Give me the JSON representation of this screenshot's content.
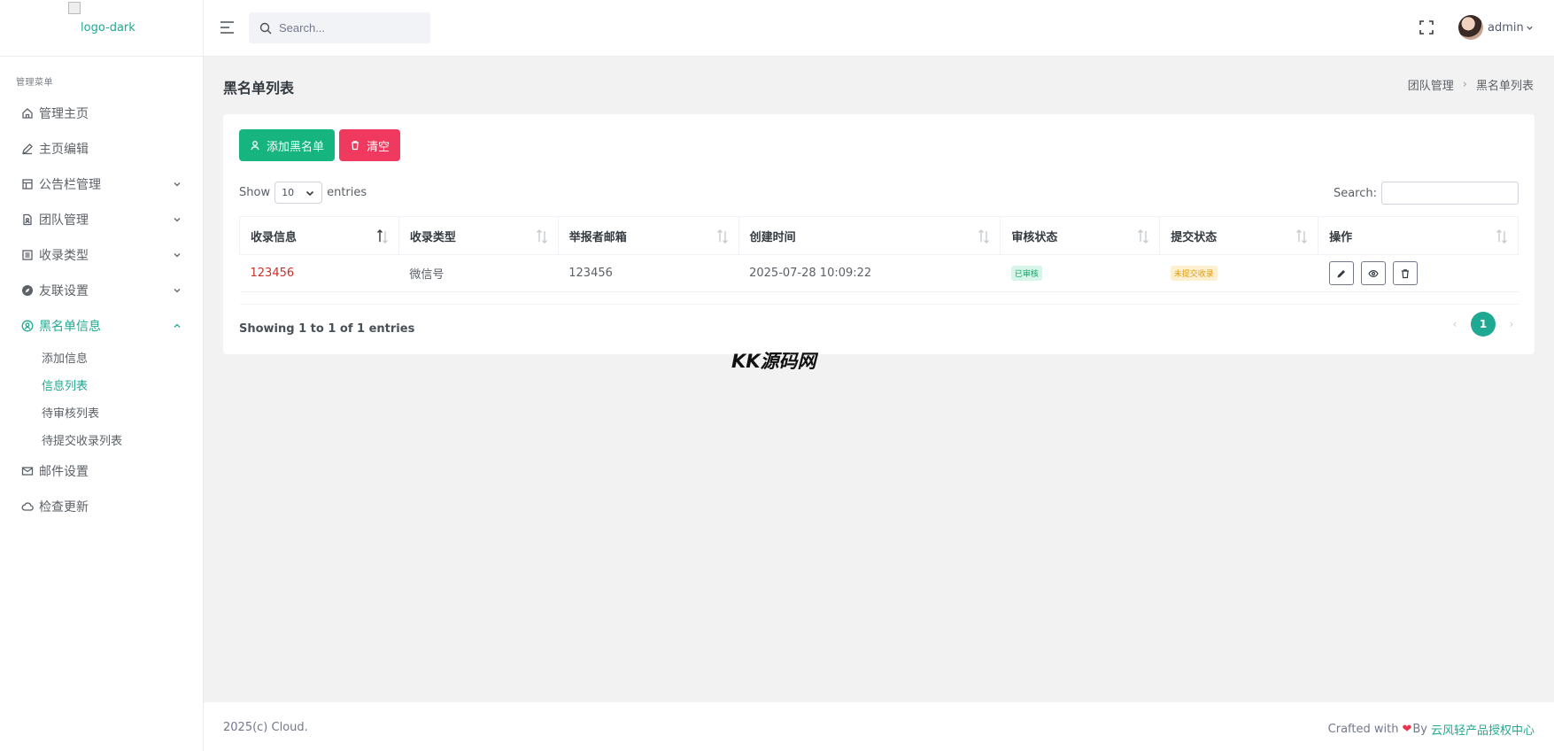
{
  "logo": {
    "alt": "logo-dark"
  },
  "search": {
    "placeholder": "Search..."
  },
  "user": {
    "name": "admin"
  },
  "sidebar": {
    "menu_title": "管理菜单",
    "items": [
      {
        "label": "管理主页",
        "icon": "home-icon"
      },
      {
        "label": "主页编辑",
        "icon": "edit-icon"
      },
      {
        "label": "公告栏管理",
        "icon": "layout-icon"
      },
      {
        "label": "团队管理",
        "icon": "file-user-icon"
      },
      {
        "label": "收录类型",
        "icon": "list-box-icon"
      },
      {
        "label": "友联设置",
        "icon": "compass-icon"
      },
      {
        "label": "黑名单信息",
        "icon": "user-pin-icon"
      }
    ],
    "sub_items": [
      {
        "label": "添加信息"
      },
      {
        "label": "信息列表"
      },
      {
        "label": "待审核列表"
      },
      {
        "label": "待提交收录列表"
      }
    ],
    "bottom_items": [
      {
        "label": "邮件设置",
        "icon": "mail-icon"
      },
      {
        "label": "检查更新",
        "icon": "cloud-icon"
      }
    ]
  },
  "page": {
    "title": "黑名单列表",
    "breadcrumb": [
      "团队管理",
      "黑名单列表"
    ]
  },
  "toolbar": {
    "add_label": "添加黑名单",
    "clear_label": "清空"
  },
  "table": {
    "show_label": "Show",
    "page_size": "10",
    "entries_label": "entries",
    "search_label": "Search:",
    "columns": [
      "收录信息",
      "收录类型",
      "举报者邮箱",
      "创建时间",
      "审核状态",
      "提交状态",
      "操作"
    ],
    "rows": [
      {
        "info": "123456",
        "type": "微信号",
        "email": "123456",
        "created": "2025-07-28 10:09:22",
        "review_status": "已审核",
        "submit_status": "未提交收录"
      }
    ],
    "showing": "Showing 1 to 1 of 1 entries",
    "current_page": "1",
    "prev": "‹",
    "next": "›"
  },
  "watermark": "KK源码网",
  "footer": {
    "copyright": "2025(c) Cloud.",
    "crafted": "Crafted with",
    "heart": "❤",
    "by": "By",
    "brand": "云风轻产品授权中心"
  },
  "colors": {
    "accent": "#20a992",
    "add_button": "#16b57f",
    "clear_button": "#f0395e",
    "link_red": "#c9302c",
    "badge_ok": "#11a86c",
    "badge_warn": "#e09c12"
  }
}
